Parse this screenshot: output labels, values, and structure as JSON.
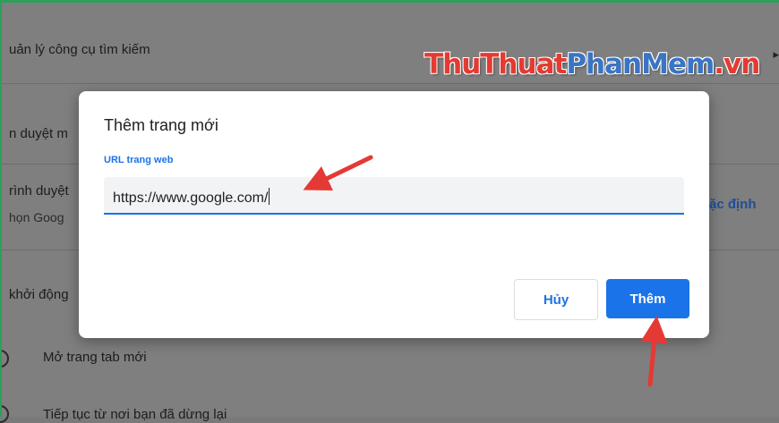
{
  "background": {
    "rows": [
      "uản lý công cụ tìm kiếm",
      "n duyệt m",
      "rình duyệt",
      "họn Goog",
      "ặc định",
      "khởi động",
      "Mở trang tab mới",
      "Tiếp tục từ nơi bạn đã dừng lại"
    ]
  },
  "watermark": {
    "part1": "ThuThuat",
    "part2": "PhanMem",
    "part3": ".vn"
  },
  "dialog": {
    "title": "Thêm trang mới",
    "field_label": "URL trang web",
    "url_value": "https://www.google.com/",
    "cancel_label": "Hủy",
    "add_label": "Thêm"
  },
  "colors": {
    "accent": "#1a73e8",
    "annotation": "#e53935"
  },
  "icons": [
    "chevron-right-icon",
    "radio-icon",
    "arrow-annotation-icon"
  ]
}
